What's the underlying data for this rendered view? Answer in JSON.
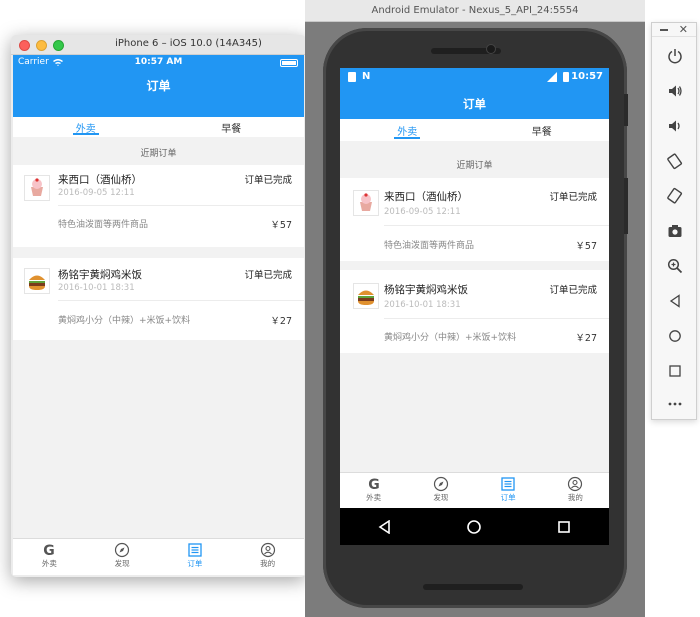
{
  "ios": {
    "window_title": "iPhone 6 – iOS 10.0 (14A345)",
    "status": {
      "carrier": "Carrier",
      "time": "10:57 AM"
    },
    "nav_title": "订单",
    "tabs": [
      {
        "label": "外卖",
        "active": true
      },
      {
        "label": "早餐",
        "active": false
      }
    ],
    "section_label": "近期订单",
    "orders": [
      {
        "shop": "来西口（酒仙桥）",
        "date": "2016-09-05 12:11",
        "status": "订单已完成",
        "goods": "特色油泼面等两件商品",
        "price": "￥57",
        "thumb_icon": "cupcake-icon"
      },
      {
        "shop": "杨铭宇黄焖鸡米饭",
        "date": "2016-10-01 18:31",
        "status": "订单已完成",
        "goods": "黄焖鸡小分（中辣）+米饭+饮料",
        "price": "￥27",
        "thumb_icon": "burger-icon"
      }
    ],
    "tabbar": [
      {
        "label": "外卖",
        "icon": "g-logo-icon",
        "active": false
      },
      {
        "label": "发现",
        "icon": "compass-icon",
        "active": false
      },
      {
        "label": "订单",
        "icon": "list-icon",
        "active": true
      },
      {
        "label": "我的",
        "icon": "user-icon",
        "active": false
      }
    ]
  },
  "android": {
    "window_title": "Android Emulator - Nexus_5_API_24:5554",
    "status": {
      "time": "10:57"
    },
    "nav_title": "订单",
    "tabs": [
      {
        "label": "外卖",
        "active": true
      },
      {
        "label": "早餐",
        "active": false
      }
    ],
    "section_label": "近期订单",
    "orders": [
      {
        "shop": "来西口（酒仙桥）",
        "date": "2016-09-05 12:11",
        "status": "订单已完成",
        "goods": "特色油泼面等两件商品",
        "price": "￥57",
        "thumb_icon": "cupcake-icon"
      },
      {
        "shop": "杨铭宇黄焖鸡米饭",
        "date": "2016-10-01 18:31",
        "status": "订单已完成",
        "goods": "黄焖鸡小分（中辣）+米饭+饮料",
        "price": "￥27",
        "thumb_icon": "burger-icon"
      }
    ],
    "tabbar": [
      {
        "label": "外卖",
        "icon": "g-logo-icon",
        "active": false
      },
      {
        "label": "发现",
        "icon": "compass-icon",
        "active": false
      },
      {
        "label": "订单",
        "icon": "list-icon",
        "active": true
      },
      {
        "label": "我的",
        "icon": "user-icon",
        "active": false
      }
    ],
    "navbar": [
      "back-icon",
      "home-icon",
      "overview-icon"
    ]
  },
  "emulator_toolbar": [
    "power-icon",
    "volume-up-icon",
    "volume-down-icon",
    "rotate-left-icon",
    "rotate-right-icon",
    "screenshot-icon",
    "zoom-icon",
    "back-icon",
    "home-icon",
    "overview-icon",
    "more-icon"
  ],
  "colors": {
    "primary": "#2196f3",
    "background": "#f2f2f2",
    "text_muted": "#888888"
  }
}
